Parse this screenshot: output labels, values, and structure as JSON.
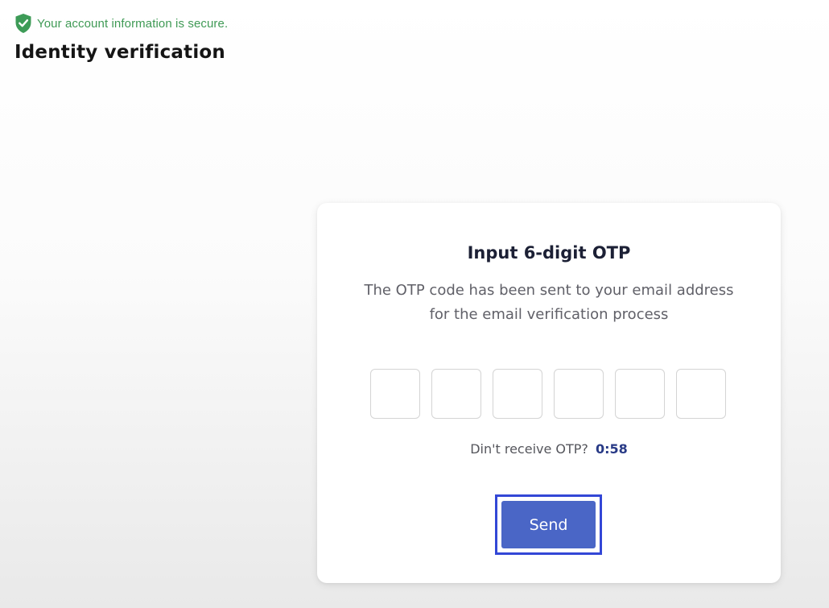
{
  "header": {
    "secure_text": "Your account information is secure.",
    "secure_icon": "shield-check-icon",
    "title": "Identity verification"
  },
  "otp_card": {
    "title": "Input 6-digit OTP",
    "description": "The OTP code has been sent to your email address for the email verification process",
    "digits": [
      "",
      "",
      "",
      "",
      "",
      ""
    ],
    "resend_prompt": "Din't receive OTP?",
    "countdown": "0:58",
    "send_label": "Send"
  },
  "colors": {
    "secure_green": "#3f9a55",
    "button_blue": "#4a66c6",
    "highlight_blue": "#3347d6",
    "countdown_blue": "#283a86"
  }
}
